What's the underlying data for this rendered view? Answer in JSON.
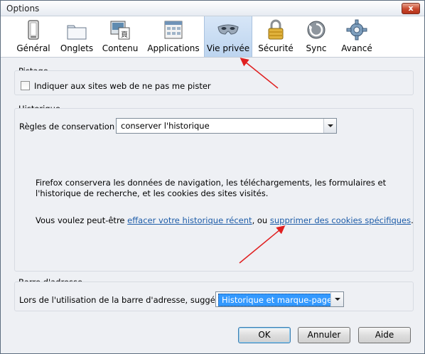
{
  "window": {
    "title": "Options",
    "close_label": "x"
  },
  "tabs": [
    {
      "label": "Général",
      "accel": "",
      "icon": "general-icon"
    },
    {
      "label": "Onglets",
      "icon": "tabs-icon"
    },
    {
      "label": "Contenu",
      "icon": "content-icon"
    },
    {
      "label": "Applications",
      "icon": "applications-icon"
    },
    {
      "label": "Vie privée",
      "icon": "privacy-mask-icon",
      "selected": true
    },
    {
      "label": "Sécurité",
      "icon": "lock-icon"
    },
    {
      "label": "Sync",
      "icon": "sync-icon"
    },
    {
      "label": "Avancé",
      "icon": "gear-icon"
    }
  ],
  "tracking": {
    "title": "Pistage",
    "checkbox_label": "Indiquer aux sites web de ne pas me pister",
    "checked": false
  },
  "history": {
    "title": "Historique",
    "rules_label": "Règles de conservation :",
    "rules_value": "conserver l'historique",
    "info_line1": "Firefox conservera les données de navigation, les téléchargements, les formulaires et",
    "info_line2": "l'historique de recherche, et les cookies des sites visités.",
    "maybe_prefix": "Vous voulez peut-être ",
    "clear_link": "effacer votre historique récent",
    "separator": ", ou ",
    "cookies_link": "supprimer des cookies spécifiques",
    "suffix": "."
  },
  "address_bar": {
    "title": "Barre d'adresse",
    "suggest_label": "Lors de l'utilisation de la barre d'adresse, suggérer :",
    "suggest_value": "Historique et marque-pages"
  },
  "buttons": {
    "ok": "OK",
    "cancel": "Annuler",
    "help": "Aide"
  },
  "colors": {
    "accent": "#3399ff",
    "link": "#1d5ca8",
    "annotation": "#e02020"
  }
}
